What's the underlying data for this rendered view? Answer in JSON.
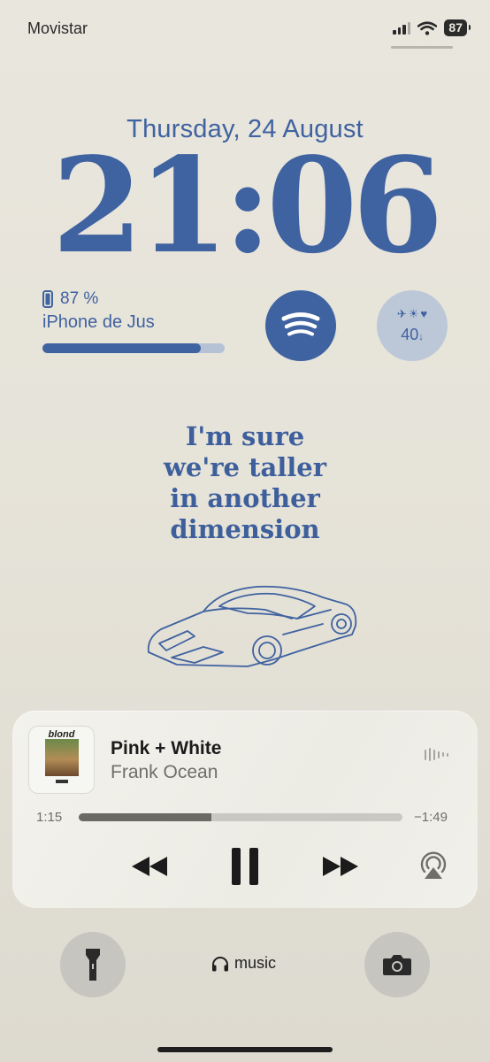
{
  "status_bar": {
    "carrier": "Movistar",
    "battery_level": "87",
    "signal_bars_active": 3,
    "signal_bars_total": 4
  },
  "lock_screen": {
    "date": "Thursday, 24 August",
    "time": "21:06"
  },
  "widgets": {
    "battery": {
      "percent_text": "87 %",
      "device_name": "iPhone de Jus",
      "level_fraction": 0.87
    },
    "spotify": {
      "icon": "spotify-icon"
    },
    "weather": {
      "icons": [
        "airplane-icon",
        "sun-icon",
        "heart-icon"
      ],
      "value": "40",
      "trend_symbol": "↓"
    }
  },
  "wallpaper": {
    "quote_lines": [
      "I'm sure",
      "we're taller",
      "in another",
      "dimension"
    ]
  },
  "now_playing": {
    "album_label": "blond",
    "title": "Pink + White",
    "artist": "Frank Ocean",
    "elapsed": "1:15",
    "remaining": "−1:49",
    "progress_fraction": 0.41
  },
  "bottom_bar": {
    "focus_label": "music"
  },
  "colors": {
    "accent_blue": "#3f62a0",
    "background": "#e8e5dc",
    "player_bg": "#f1f0ea"
  }
}
